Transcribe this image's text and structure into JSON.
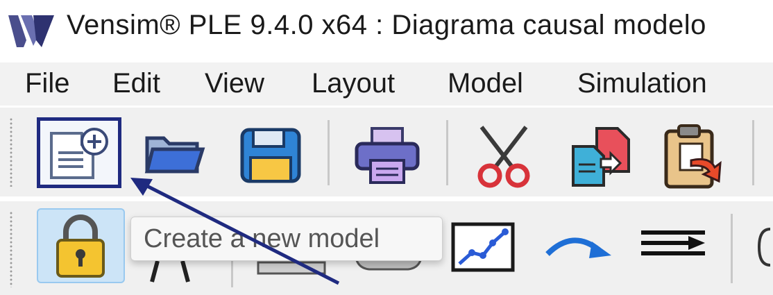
{
  "window": {
    "title": "Vensim® PLE 9.4.0 x64 : Diagrama causal modelo",
    "logo_icon": "vensim-logo-icon"
  },
  "menu": {
    "items": [
      "File",
      "Edit",
      "View",
      "Layout",
      "Model",
      "Simulation"
    ]
  },
  "toolbar": {
    "buttons": [
      {
        "icon": "new-model-icon",
        "highlighted": true
      },
      {
        "icon": "open-folder-icon"
      },
      {
        "icon": "save-icon"
      },
      {
        "icon": "print-icon"
      },
      {
        "icon": "cut-icon"
      },
      {
        "icon": "copy-icon"
      },
      {
        "icon": "paste-icon"
      }
    ]
  },
  "sketch_toolbar": {
    "buttons": [
      {
        "icon": "lock-icon",
        "active": true
      },
      {
        "icon": "variable-icon"
      },
      {
        "icon": "box-variable-icon"
      },
      {
        "icon": "rate-icon"
      },
      {
        "icon": "graph-lookup-icon"
      },
      {
        "icon": "arrow-icon"
      },
      {
        "icon": "flow-icon"
      },
      {
        "icon": "comment-icon"
      }
    ]
  },
  "tooltip": {
    "text": "Create a new model"
  },
  "colors": {
    "highlight_border": "#1f2a80",
    "arrow": "#1f2a80",
    "lock_active_bg": "#cce4f7"
  }
}
